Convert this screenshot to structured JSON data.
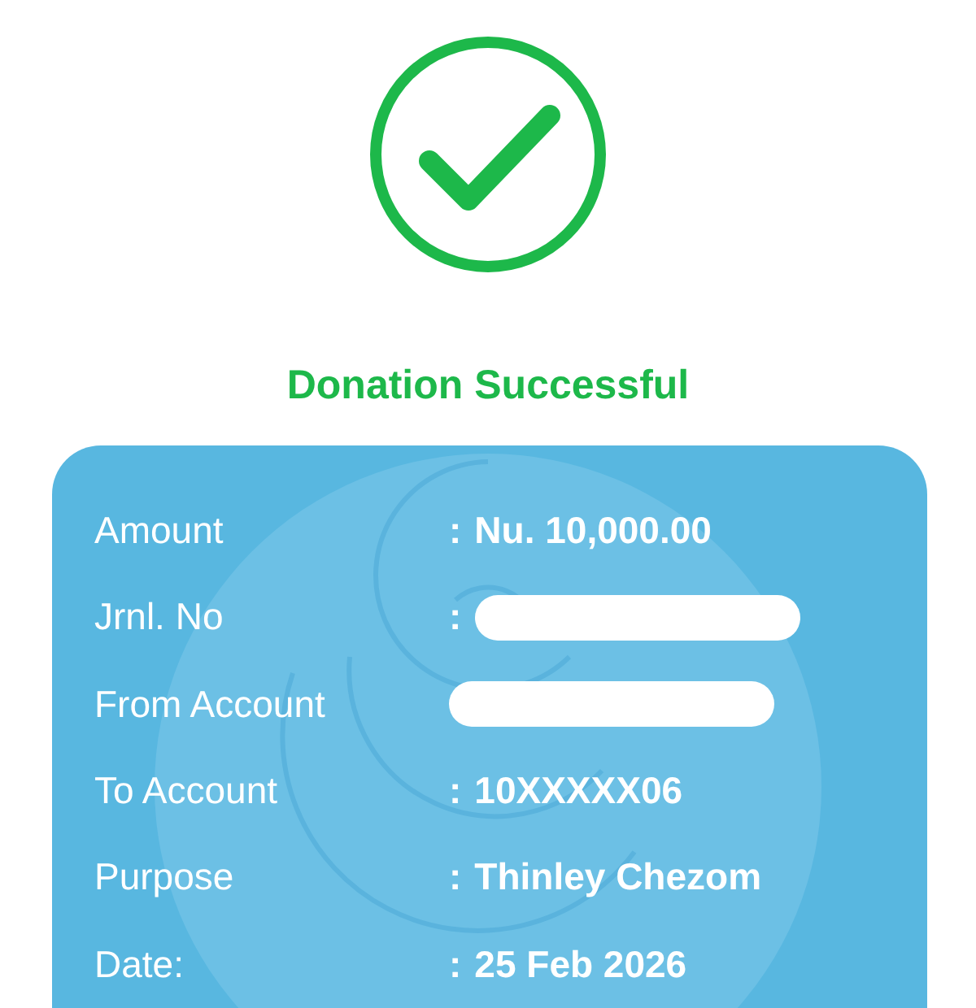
{
  "status": {
    "title": "Donation Successful"
  },
  "details": [
    {
      "label": "Amount",
      "colon": ":",
      "value": "Nu. 10,000.00",
      "redacted": false
    },
    {
      "label": "Jrnl. No",
      "colon": ":",
      "redacted": true
    },
    {
      "label": "From Account",
      "redacted": true
    },
    {
      "label": "To Account",
      "colon": ":",
      "value": "10XXXXX06",
      "redacted": false
    },
    {
      "label": "Purpose",
      "colon": ":",
      "value": "Thinley Chezom",
      "redacted": false
    },
    {
      "label": "Date:",
      "colon": ":",
      "value": "25 Feb 2026",
      "redacted": false
    }
  ]
}
